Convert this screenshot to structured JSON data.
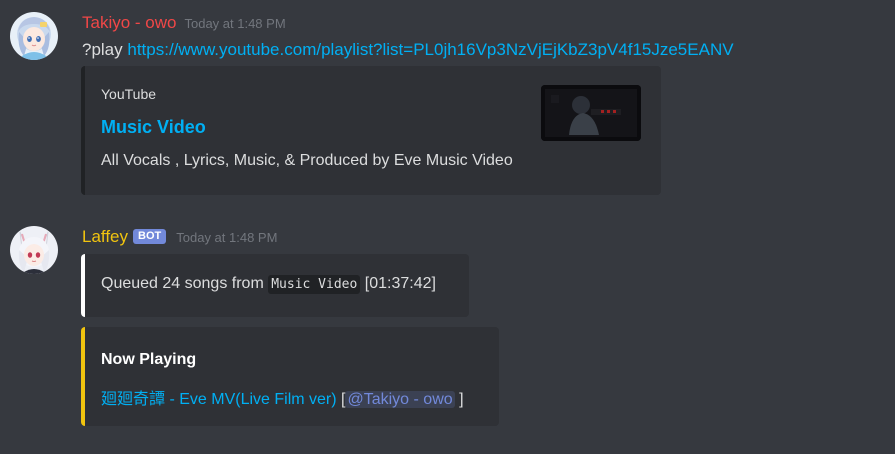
{
  "messages": [
    {
      "username": "Takiyo - owo",
      "timestamp": "Today at 1:48 PM",
      "command": "?play",
      "url": "https://www.youtube.com/playlist?list=PL0jh16Vp3NzVjEjKbZ3pV4f15Jze5EANV",
      "embed": {
        "provider": "YouTube",
        "title": "Music Video",
        "description": "All Vocals , Lyrics, Music, & Produced by Eve Music Video",
        "accent_color": "#202225"
      }
    },
    {
      "username": "Laffey",
      "bot_tag": "BOT",
      "timestamp": "Today at 1:48 PM",
      "queued_embed": {
        "prefix": "Queued 24 songs from",
        "playlist_code": "Music Video",
        "duration": "[01:37:42]",
        "accent_color": "#ffffff"
      },
      "now_playing_embed": {
        "title": "Now Playing",
        "track_link": "廻廻奇譚 - Eve MV(Live Film ver)",
        "bracket_open": "[",
        "mention": "@Takiyo - owo",
        "bracket_close": "]",
        "accent_color": "#f1c40f"
      }
    }
  ],
  "colors": {
    "background": "#36393f",
    "embed_bg": "#2f3136",
    "link": "#00b0f4",
    "username_user": "#f04747",
    "username_bot": "#f1c40f",
    "bot_tag": "#7289da"
  }
}
